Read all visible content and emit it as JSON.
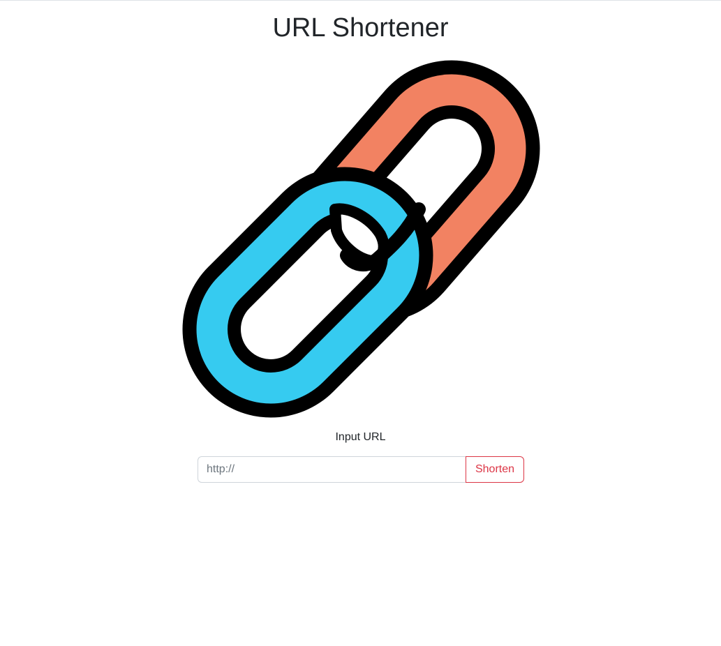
{
  "header": {
    "title": "URL Shortener"
  },
  "logo": {
    "icon": "chain-link-icon",
    "colors": {
      "outline": "#000000",
      "back_link": "#f28262",
      "front_link": "#36cbf0"
    }
  },
  "form": {
    "label": "Input URL",
    "url_input": {
      "value": "",
      "placeholder": "http://"
    },
    "submit_label": "Shorten",
    "accent_color": "#dc3545"
  }
}
